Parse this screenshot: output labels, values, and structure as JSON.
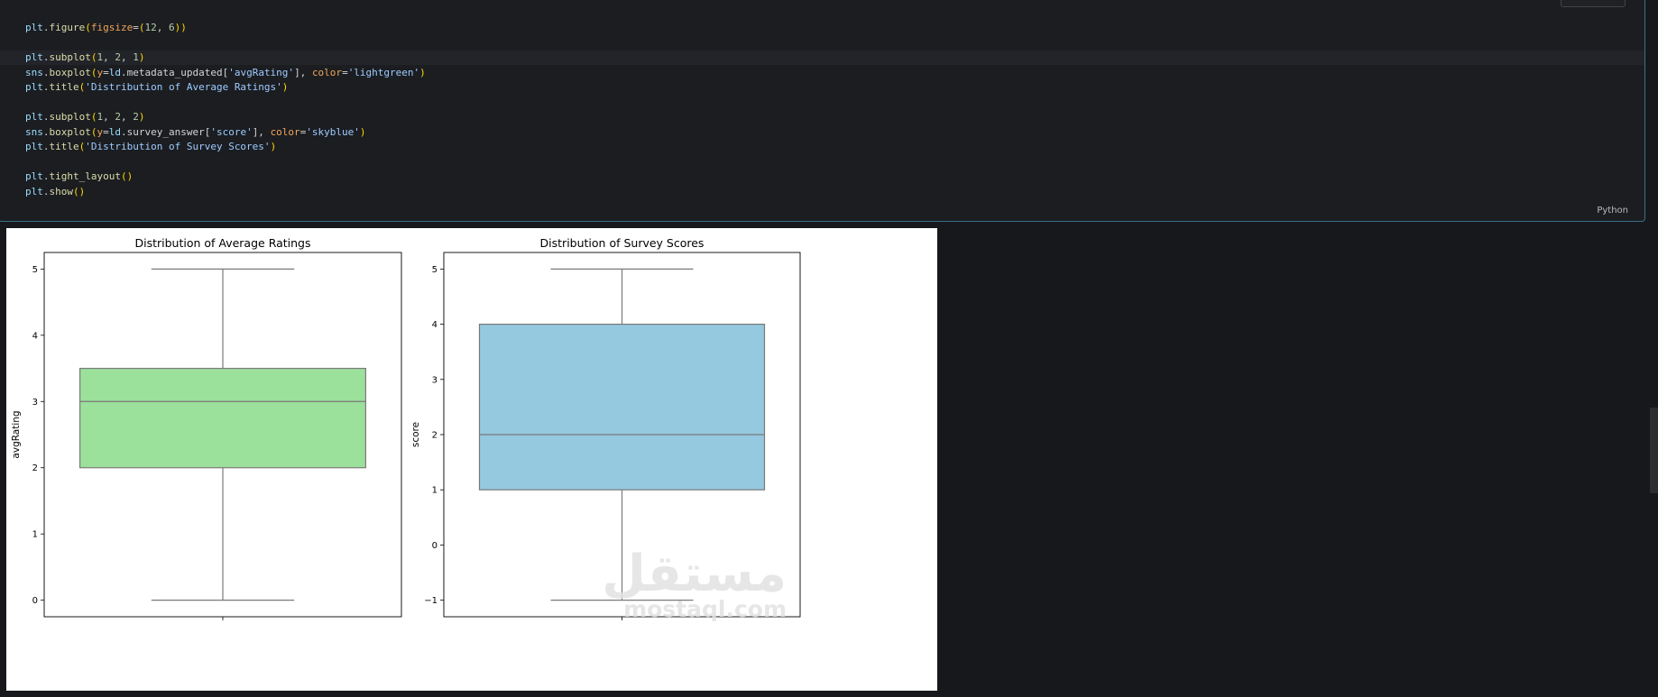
{
  "code_cell": {
    "lines": [
      [
        [
          "v",
          "plt"
        ],
        [
          "o",
          "."
        ],
        [
          "f",
          "figure"
        ],
        [
          "p",
          "("
        ],
        [
          "kw",
          "figsize"
        ],
        [
          "o",
          "="
        ],
        [
          "p",
          "("
        ],
        [
          "n",
          "12"
        ],
        [
          "o",
          ", "
        ],
        [
          "n",
          "6"
        ],
        [
          "p",
          "))"
        ]
      ],
      [],
      [
        [
          "v",
          "plt"
        ],
        [
          "o",
          "."
        ],
        [
          "f",
          "subplot"
        ],
        [
          "p",
          "("
        ],
        [
          "n",
          "1"
        ],
        [
          "o",
          ", "
        ],
        [
          "n",
          "2"
        ],
        [
          "o",
          ", "
        ],
        [
          "n",
          "1"
        ],
        [
          "p",
          ")"
        ]
      ],
      [
        [
          "v",
          "sns"
        ],
        [
          "o",
          "."
        ],
        [
          "f",
          "boxplot"
        ],
        [
          "p",
          "("
        ],
        [
          "kw",
          "y"
        ],
        [
          "o",
          "="
        ],
        [
          "v",
          "ld"
        ],
        [
          "o",
          ".metadata_updated"
        ],
        [
          "o",
          "["
        ],
        [
          "str",
          "'avgRating'"
        ],
        [
          "o",
          "], "
        ],
        [
          "kw",
          "color"
        ],
        [
          "o",
          "="
        ],
        [
          "str",
          "'lightgreen'"
        ],
        [
          "p",
          ")"
        ]
      ],
      [
        [
          "v",
          "plt"
        ],
        [
          "o",
          "."
        ],
        [
          "f",
          "title"
        ],
        [
          "p",
          "("
        ],
        [
          "str",
          "'Distribution of Average Ratings'"
        ],
        [
          "p",
          ")"
        ]
      ],
      [],
      [
        [
          "v",
          "plt"
        ],
        [
          "o",
          "."
        ],
        [
          "f",
          "subplot"
        ],
        [
          "p",
          "("
        ],
        [
          "n",
          "1"
        ],
        [
          "o",
          ", "
        ],
        [
          "n",
          "2"
        ],
        [
          "o",
          ", "
        ],
        [
          "n",
          "2"
        ],
        [
          "p",
          ")"
        ]
      ],
      [
        [
          "v",
          "sns"
        ],
        [
          "o",
          "."
        ],
        [
          "f",
          "boxplot"
        ],
        [
          "p",
          "("
        ],
        [
          "kw",
          "y"
        ],
        [
          "o",
          "="
        ],
        [
          "v",
          "ld"
        ],
        [
          "o",
          ".survey_answer"
        ],
        [
          "o",
          "["
        ],
        [
          "str",
          "'score'"
        ],
        [
          "o",
          "], "
        ],
        [
          "kw",
          "color"
        ],
        [
          "o",
          "="
        ],
        [
          "str",
          "'skyblue'"
        ],
        [
          "p",
          ")"
        ]
      ],
      [
        [
          "v",
          "plt"
        ],
        [
          "o",
          "."
        ],
        [
          "f",
          "title"
        ],
        [
          "p",
          "("
        ],
        [
          "str",
          "'Distribution of Survey Scores'"
        ],
        [
          "p",
          ")"
        ]
      ],
      [],
      [
        [
          "v",
          "plt"
        ],
        [
          "o",
          "."
        ],
        [
          "f",
          "tight_layout"
        ],
        [
          "p",
          "()"
        ]
      ],
      [
        [
          "v",
          "plt"
        ],
        [
          "o",
          "."
        ],
        [
          "f",
          "show"
        ],
        [
          "p",
          "()"
        ]
      ]
    ],
    "language": "Python"
  },
  "watermark": {
    "arabic": "مستقل",
    "latin": "mostaql.com"
  },
  "chart_data": [
    {
      "type": "boxplot",
      "title": "Distribution of Average Ratings",
      "ylabel": "avgRating",
      "xlabel": "",
      "color": "#9be09b",
      "yticks": [
        0,
        1,
        2,
        3,
        4,
        5
      ],
      "ylim": [
        -0.25,
        5.25
      ],
      "stats": {
        "min": 0,
        "q1": 2,
        "median": 3,
        "q3": 3.5,
        "max": 5
      }
    },
    {
      "type": "boxplot",
      "title": "Distribution of Survey Scores",
      "ylabel": "score",
      "xlabel": "",
      "color": "#95c9df",
      "yticks": [
        -1,
        0,
        1,
        2,
        3,
        4,
        5
      ],
      "ylim": [
        -1.3,
        5.3
      ],
      "stats": {
        "min": -1,
        "q1": 1,
        "median": 2,
        "q3": 4,
        "max": 5
      }
    }
  ]
}
